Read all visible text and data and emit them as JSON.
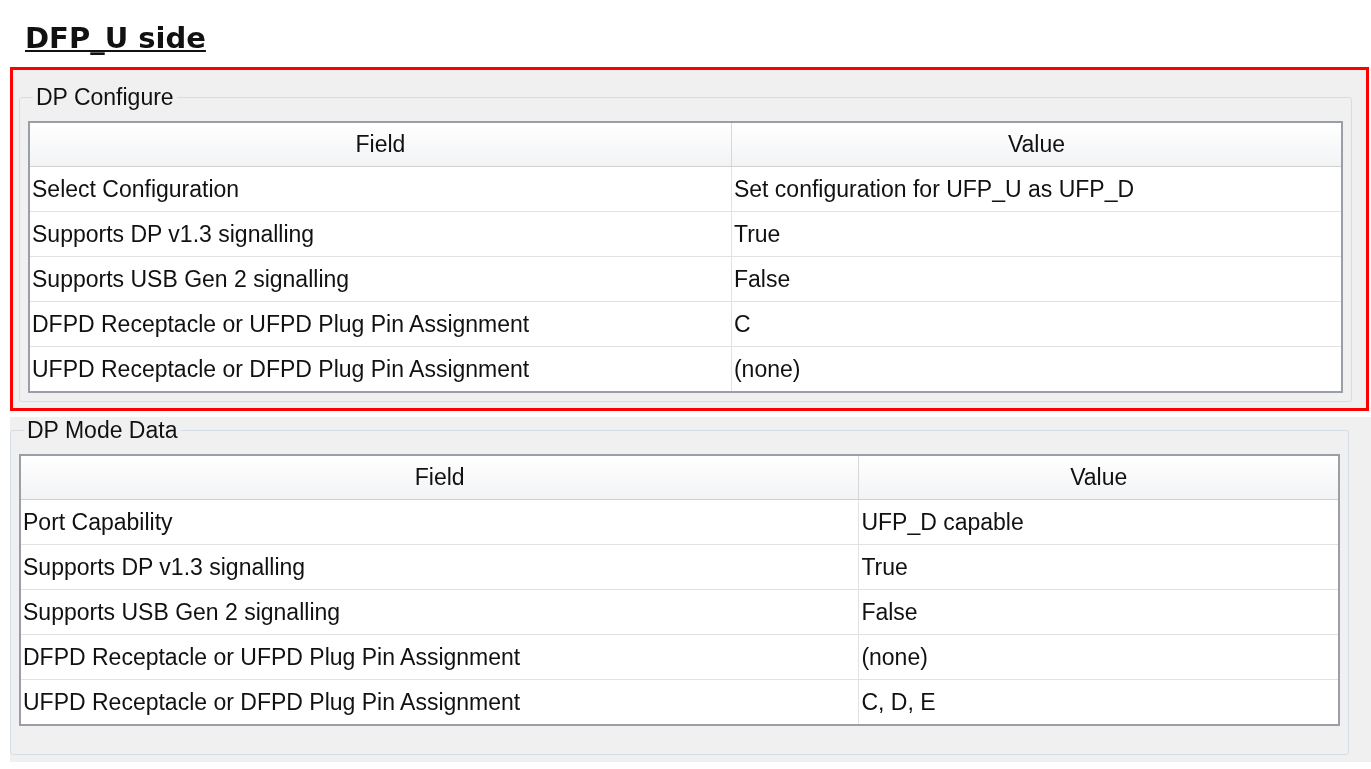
{
  "heading": "DFP_U side",
  "sections": [
    {
      "title": "DP Configure",
      "highlighted": true,
      "columns": [
        "Field",
        "Value"
      ],
      "rows": [
        [
          "Select Configuration",
          "Set configuration for UFP_U as UFP_D"
        ],
        [
          "Supports DP v1.3 signalling",
          "True"
        ],
        [
          "Supports USB Gen 2 signalling",
          "False"
        ],
        [
          "DFPD Receptacle or UFPD Plug Pin Assignment",
          "C"
        ],
        [
          "UFPD Receptacle or DFPD Plug Pin Assignment",
          "(none)"
        ]
      ]
    },
    {
      "title": "DP Mode Data",
      "highlighted": false,
      "columns": [
        "Field",
        "Value"
      ],
      "rows": [
        [
          "Port Capability",
          "UFP_D capable"
        ],
        [
          "Supports DP v1.3 signalling",
          "True"
        ],
        [
          "Supports USB Gen 2 signalling",
          "False"
        ],
        [
          "DFPD Receptacle or UFPD Plug Pin Assignment",
          "(none)"
        ],
        [
          "UFPD Receptacle or DFPD Plug Pin Assignment",
          "C, D, E"
        ]
      ]
    }
  ]
}
